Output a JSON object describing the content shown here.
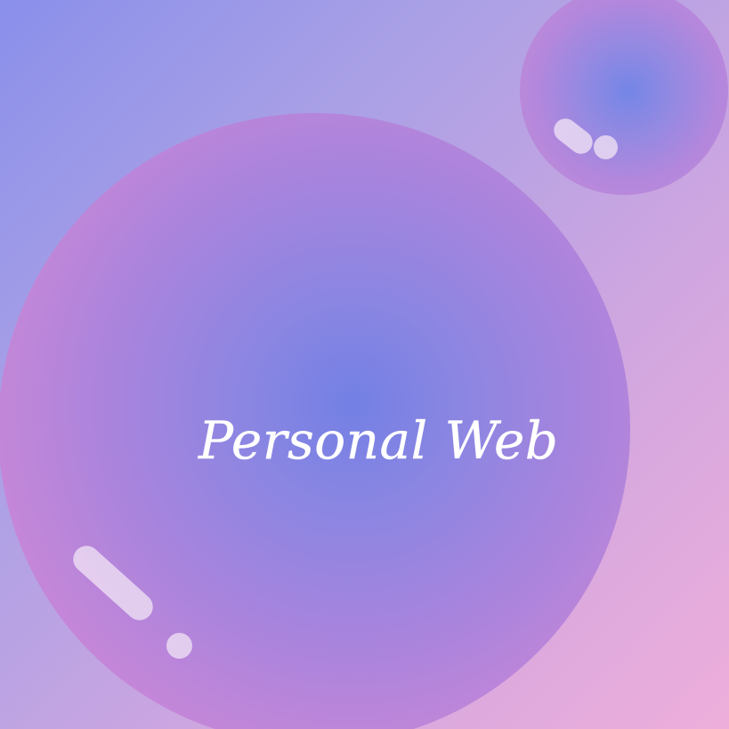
{
  "title": {
    "text": "Personal Web"
  },
  "colors": {
    "background_start": "#8a8fea",
    "background_end": "#eeaedb",
    "bubble_center": "#7380e4",
    "bubble_edge": "#d08ad6",
    "highlight": "#f0e1f5",
    "title_text": "#ffffff"
  }
}
